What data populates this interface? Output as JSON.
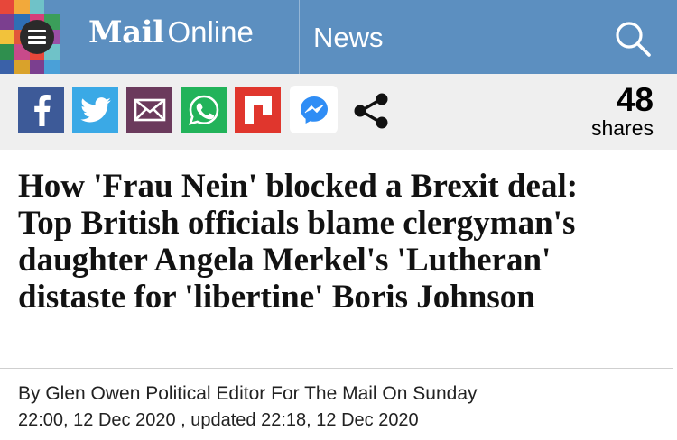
{
  "header": {
    "brand_mail": "Mail",
    "brand_online": "Online",
    "section": "News",
    "background": "#5c8fc0",
    "menu_icon": "menu-icon",
    "search_icon": "search-icon",
    "tile_colors": [
      "#e7473a",
      "#f2a93b",
      "#6fc2c8",
      "#5c8fc0",
      "#5c8fc0",
      "#7b3f8f",
      "#2e6fb5",
      "#d63f7a",
      "#3b9e5a",
      "#5c8fc0",
      "#f2c23b",
      "#e2573a",
      "#4aa0d8",
      "#9a4fa6",
      "#5c8fc0",
      "#2f8f4e",
      "#c84a8a",
      "#e7473a",
      "#6fc2c8",
      "#5c8fc0",
      "#3a61a8",
      "#d9a22b",
      "#7b3f8f",
      "#4aa0d8",
      "#5c8fc0"
    ]
  },
  "sharebar": {
    "buttons": [
      {
        "name": "facebook",
        "icon": "facebook-icon",
        "color": "#3d5a98"
      },
      {
        "name": "twitter",
        "icon": "twitter-icon",
        "color": "#3aa9e6"
      },
      {
        "name": "email",
        "icon": "email-icon",
        "color": "#6b3a5c"
      },
      {
        "name": "whatsapp",
        "icon": "whatsapp-icon",
        "color": "#22b35a"
      },
      {
        "name": "flipboard",
        "icon": "flipboard-icon",
        "color": "#e0362d"
      },
      {
        "name": "messenger",
        "icon": "messenger-icon",
        "color": "#ffffff"
      },
      {
        "name": "share",
        "icon": "share-icon",
        "color": "#000000"
      }
    ],
    "count": "48",
    "count_label": "shares"
  },
  "article": {
    "headline_lines": [
      "How 'Frau Nein' blocked a Brexit deal:",
      "Top British officials blame clergyman's",
      "daughter Angela Merkel's 'Lutheran'",
      "distaste for 'libertine' Boris Johnson"
    ],
    "byline": "By Glen Owen Political Editor For The Mail On Sunday",
    "dateline": "22:00, 12 Dec 2020 , updated 22:18, 12 Dec 2020"
  }
}
